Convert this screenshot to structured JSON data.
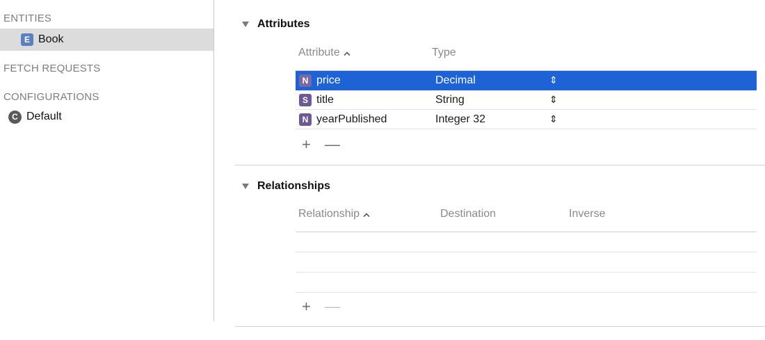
{
  "sidebar": {
    "entities_header": "ENTITIES",
    "entities": [
      {
        "badge": "E",
        "label": "Book",
        "selected": true
      }
    ],
    "fetch_requests_header": "FETCH REQUESTS",
    "configurations_header": "CONFIGURATIONS",
    "configurations": [
      {
        "badge": "C",
        "label": "Default"
      }
    ]
  },
  "attributes": {
    "title": "Attributes",
    "columns": {
      "attribute": "Attribute",
      "type": "Type"
    },
    "rows": [
      {
        "badge": "N",
        "name": "price",
        "type": "Decimal",
        "stepper": "◇",
        "selected": true
      },
      {
        "badge": "S",
        "name": "title",
        "type": "String",
        "stepper": "◇",
        "selected": false
      },
      {
        "badge": "N",
        "name": "yearPublished",
        "type": "Integer 32",
        "stepper": "◇",
        "selected": false
      }
    ],
    "add_label": "+",
    "remove_label": "—"
  },
  "relationships": {
    "title": "Relationships",
    "columns": {
      "relationship": "Relationship",
      "destination": "Destination",
      "inverse": "Inverse"
    },
    "rows": [],
    "add_label": "+",
    "remove_label": "—"
  },
  "colors": {
    "selection": "#1d63d6",
    "sidebar_selection": "#dcdcdc",
    "entity_badge": "#5b7fbf",
    "attribute_badge": "#6d5a94"
  }
}
